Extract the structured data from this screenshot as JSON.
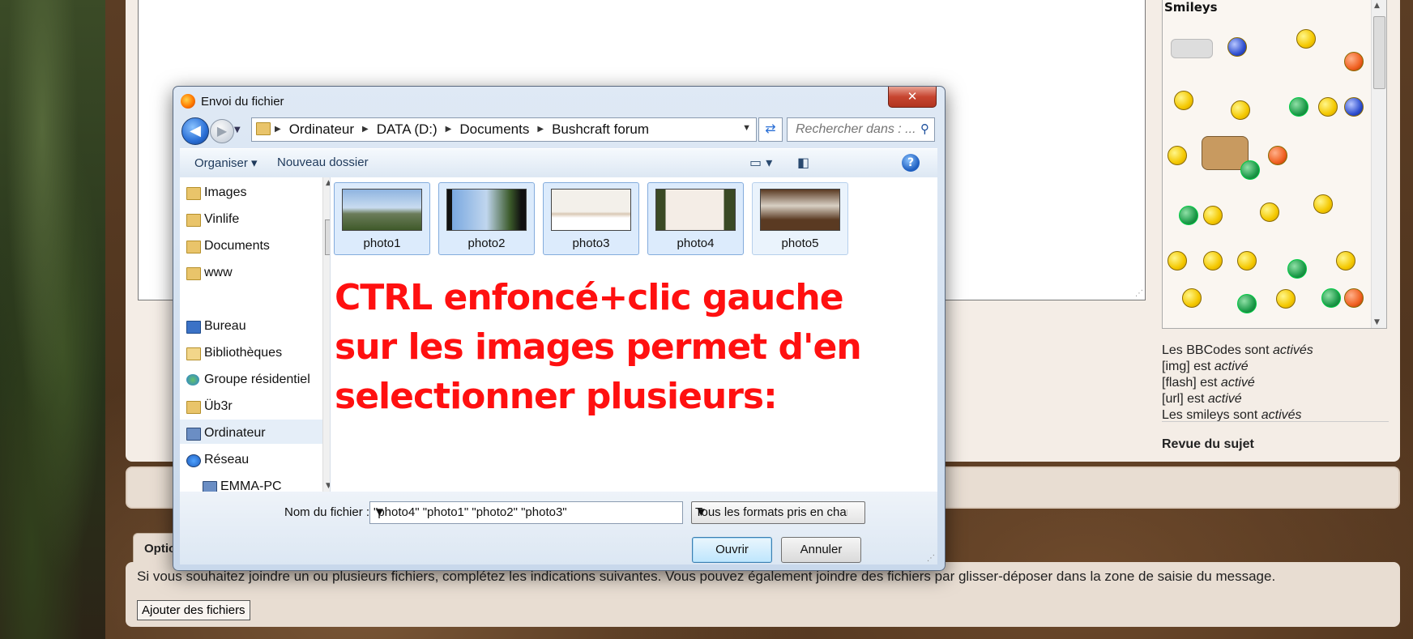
{
  "dialog": {
    "title": "Envoi du fichier",
    "close_label": "✕",
    "breadcrumb": [
      "Ordinateur",
      "DATA (D:)",
      "Documents",
      "Bushcraft forum"
    ],
    "search_placeholder": "Rechercher dans : ...",
    "toolbar": {
      "organize": "Organiser ▾",
      "new_folder": "Nouveau dossier"
    },
    "nav_items": [
      "Images",
      "Vinlife",
      "Documents",
      "www",
      "Bureau",
      "Bibliothèques",
      "Groupe résidentiel",
      "Üb3r",
      "Ordinateur",
      "Réseau",
      "EMMA-PC"
    ],
    "files": [
      {
        "name": "photo1",
        "selected": true
      },
      {
        "name": "photo2",
        "selected": true
      },
      {
        "name": "photo3",
        "selected": true
      },
      {
        "name": "photo4",
        "selected": true
      },
      {
        "name": "photo5",
        "selected": false
      }
    ],
    "annotation": "CTRL enfoncé+clic gauche sur les images permet d'en selectionner plusieurs:",
    "filename_label": "Nom du fichier :",
    "filename_value": "\"photo4\" \"photo1\" \"photo2\" \"photo3\"",
    "filter_value": "Tous les formats pris en charge",
    "open_label": "Ouvrir",
    "cancel_label": "Annuler"
  },
  "sidebar": {
    "smileys_title": "Smileys",
    "bbcodes": [
      {
        "text": "Les BBCodes sont ",
        "status": "activés"
      },
      {
        "text": "[img] est ",
        "status": "activé"
      },
      {
        "text": "[flash] est ",
        "status": "activé"
      },
      {
        "text": "[url] est ",
        "status": "activé"
      },
      {
        "text": "Les smileys sont ",
        "status": "activés"
      }
    ],
    "revue": "Revue du sujet"
  },
  "options": {
    "tab_label": "Options",
    "text": "Si vous souhaitez joindre un ou plusieurs fichiers, complétez les indications suivantes. Vous pouvez également joindre des fichiers par glisser-déposer dans la zone de saisie du message.",
    "add_files_label": "Ajouter des fichiers"
  }
}
